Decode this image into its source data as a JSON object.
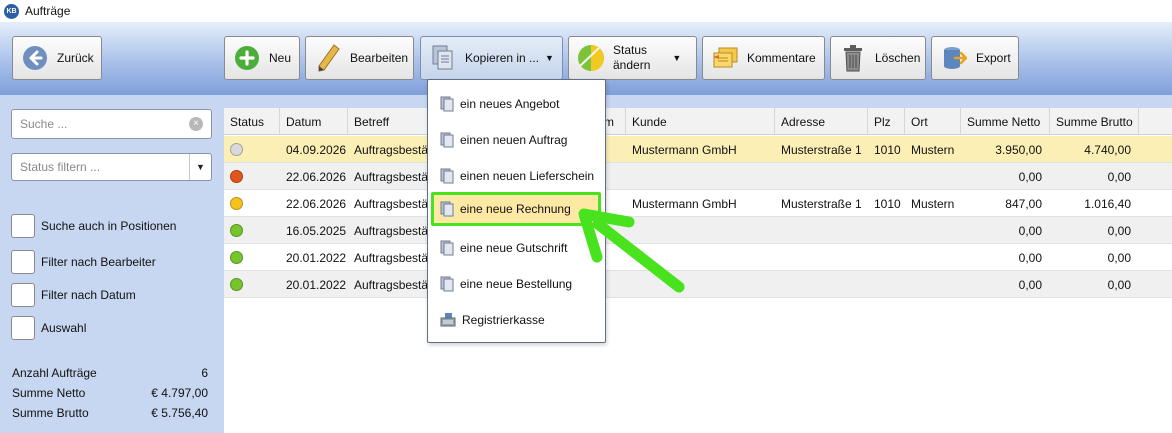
{
  "window": {
    "title": "Aufträge",
    "app_badge": "KB"
  },
  "toolbar": {
    "back_label": "Zurück",
    "new_label": "Neu",
    "edit_label": "Bearbeiten",
    "copy_label": "Kopieren in ...",
    "status_label_line1": "Status",
    "status_label_line2": "ändern",
    "comments_label": "Kommentare",
    "delete_label": "Löschen",
    "export_label": "Export"
  },
  "sidebar": {
    "search_placeholder": "Suche ...",
    "status_filter_placeholder": "Status filtern ...",
    "checkboxes": [
      {
        "label": "Suche auch in Positionen",
        "checked": false
      },
      {
        "label": "Filter nach Bearbeiter",
        "checked": false
      },
      {
        "label": "Filter nach Datum",
        "checked": false
      },
      {
        "label": "Auswahl",
        "checked": false
      }
    ],
    "stats": [
      {
        "label": "Anzahl Aufträge",
        "value": "6"
      },
      {
        "label": "Summe Netto",
        "value": "€ 4.797,00"
      },
      {
        "label": "Summe Brutto",
        "value": "€ 5.756,40"
      }
    ]
  },
  "grid": {
    "columns": {
      "status": "Status",
      "datum": "Datum",
      "betreff": "Betreff",
      "nummer": "m",
      "kunde": "Kunde",
      "adresse": "Adresse",
      "plz": "Plz",
      "ort": "Ort",
      "netto": "Summe Netto",
      "brutto": "Summe Brutto"
    },
    "rows": [
      {
        "status_color": "#d9d9d9",
        "datum": "04.09.2026",
        "betreff": "Auftragsbestä",
        "kunde": "Mustermann GmbH",
        "adresse": "Musterstraße 1",
        "plz": "1010",
        "ort": "Mustern",
        "netto": "3.950,00",
        "brutto": "4.740,00",
        "style": "sel"
      },
      {
        "status_color": "#e0561b",
        "datum": "22.06.2026",
        "betreff": "Auftragsbestä",
        "kunde": "",
        "adresse": "",
        "plz": "",
        "ort": "",
        "netto": "0,00",
        "brutto": "0,00",
        "style": "alt"
      },
      {
        "status_color": "#f6c21c",
        "datum": "22.06.2026",
        "betreff": "Auftragsbestä",
        "kunde": "Mustermann GmbH",
        "adresse": "Musterstraße 1",
        "plz": "1010",
        "ort": "Mustern",
        "netto": "847,00",
        "brutto": "1.016,40",
        "style": ""
      },
      {
        "status_color": "#76c52c",
        "datum": "16.05.2025",
        "betreff": "Auftragsbestä",
        "kunde": "",
        "adresse": "",
        "plz": "",
        "ort": "",
        "netto": "0,00",
        "brutto": "0,00",
        "style": "alt"
      },
      {
        "status_color": "#76c52c",
        "datum": "20.01.2022",
        "betreff": "Auftragsbestä",
        "kunde": "",
        "adresse": "",
        "plz": "",
        "ort": "",
        "netto": "0,00",
        "brutto": "0,00",
        "style": ""
      },
      {
        "status_color": "#76c52c",
        "datum": "20.01.2022",
        "betreff": "Auftragsbestä",
        "kunde": "",
        "adresse": "",
        "plz": "",
        "ort": "",
        "netto": "0,00",
        "brutto": "0,00",
        "style": "alt"
      }
    ]
  },
  "copy_menu": {
    "items": [
      {
        "label": "ein neues Angebot",
        "icon": "document-icon"
      },
      {
        "label": "einen neuen Auftrag",
        "icon": "document-icon"
      },
      {
        "label": "einen neuen Lieferschein",
        "icon": "document-icon"
      },
      {
        "label": "eine neue Rechnung",
        "icon": "document-icon",
        "highlighted": true
      },
      {
        "label": "eine neue Gutschrift",
        "icon": "document-icon"
      },
      {
        "label": "eine neue Bestellung",
        "icon": "document-icon"
      },
      {
        "label": "Registrierkasse",
        "icon": "cash-register-icon"
      }
    ]
  },
  "colors": {
    "accent_green": "#48e21f",
    "highlight_yellow": "#fde9a4",
    "selected_row": "#fcefb6",
    "sidebar_bg": "#c7d6f1"
  }
}
